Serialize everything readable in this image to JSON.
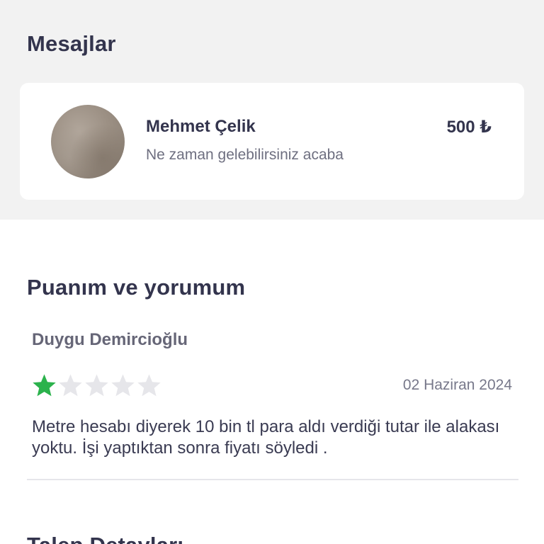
{
  "messages": {
    "title": "Mesajlar",
    "card": {
      "sender_name": "Mehmet Çelik",
      "price": "500 ₺",
      "preview": "Ne zaman gelebilirsiniz acaba",
      "avatar_icon": "avatar-photo"
    }
  },
  "reviews": {
    "title": "Puanım ve yorumum",
    "item": {
      "reviewer_name": "Duygu Demircioğlu",
      "rating": 1,
      "rating_max": 5,
      "date": "02 Haziran 2024",
      "text": "Metre hesabı diyerek 10 bin tl para aldı verdiği tutar ile alakası yoktu. İşi yaptıktan sonra fiyatı söyledi ."
    }
  },
  "details": {
    "title": "Talep Detayları"
  },
  "colors": {
    "star_filled": "#2bb24c",
    "star_empty": "#e6e6ea",
    "heading": "#33344d",
    "section_bg": "#f2f2f2"
  }
}
